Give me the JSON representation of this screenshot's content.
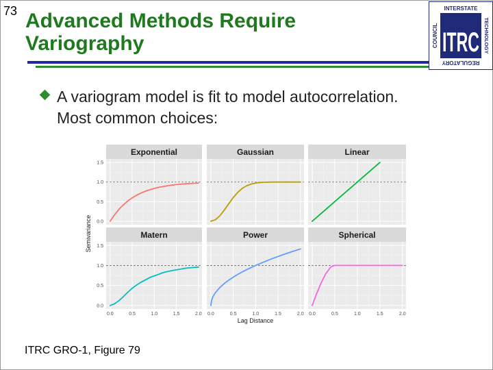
{
  "slide": {
    "number": "73",
    "title_line1": "Advanced Methods Require",
    "title_line2": "Variography",
    "bullet_line1": "A variogram model is fit to model autocorrelation.",
    "bullet_line2": "Most common choices:",
    "caption": "ITRC GRO-1, Figure 79",
    "colors": {
      "title": "#1f7a1f",
      "rule_blue": "#1f2a9c",
      "rule_green": "#2e8b2e"
    }
  },
  "logo": {
    "main": "ITRC",
    "top": "INTERSTATE",
    "right": "TECHNOLOGY",
    "bottom": "REGULATORY",
    "left": "COUNCIL"
  },
  "chart_data": {
    "type": "line",
    "xlabel": "Lag Distance",
    "ylabel": "Semivariance",
    "xlim": [
      0,
      2
    ],
    "ylim": [
      0,
      1.5
    ],
    "x_ticks": [
      "0.0",
      "0.5",
      "1.0",
      "1.5",
      "2.0"
    ],
    "y_ticks": [
      "0.0",
      "0.5",
      "1.0",
      "1.5"
    ],
    "reference_line": {
      "y": 1.0,
      "style": "dashed"
    },
    "grid": true,
    "facets": [
      {
        "name": "Exponential",
        "color": "#F8766D",
        "x": [
          0,
          0.1,
          0.2,
          0.3,
          0.4,
          0.5,
          0.6,
          0.7,
          0.8,
          0.9,
          1.0,
          1.1,
          1.2,
          1.3,
          1.4,
          1.5,
          1.6,
          1.7,
          1.8,
          1.9,
          2.0
        ],
        "y": [
          0,
          0.166,
          0.305,
          0.42,
          0.517,
          0.597,
          0.664,
          0.72,
          0.767,
          0.805,
          0.838,
          0.865,
          0.887,
          0.906,
          0.922,
          0.935,
          0.946,
          0.955,
          0.962,
          0.968,
          0.974
        ]
      },
      {
        "name": "Gaussian",
        "color": "#B79F00",
        "x": [
          0,
          0.1,
          0.2,
          0.3,
          0.4,
          0.5,
          0.6,
          0.7,
          0.8,
          0.9,
          1.0,
          1.1,
          1.2,
          1.3,
          1.4,
          1.5,
          1.6,
          1.7,
          1.8,
          1.9,
          2.0
        ],
        "y": [
          0,
          0.036,
          0.137,
          0.283,
          0.447,
          0.603,
          0.736,
          0.837,
          0.906,
          0.95,
          0.975,
          0.989,
          0.995,
          0.998,
          1,
          1,
          1,
          1,
          1,
          1,
          1
        ]
      },
      {
        "name": "Linear",
        "color": "#00BA38",
        "x": [
          0,
          1.5
        ],
        "y": [
          0,
          1.5
        ]
      },
      {
        "name": "Matern",
        "color": "#00BFC4",
        "x": [
          0,
          0.1,
          0.2,
          0.3,
          0.4,
          0.5,
          0.6,
          0.7,
          0.8,
          0.9,
          1.0,
          1.1,
          1.2,
          1.3,
          1.4,
          1.5,
          1.6,
          1.7,
          1.8,
          1.9,
          2.0
        ],
        "y": [
          0,
          0.04,
          0.12,
          0.22,
          0.33,
          0.43,
          0.51,
          0.58,
          0.64,
          0.7,
          0.74,
          0.78,
          0.82,
          0.85,
          0.87,
          0.89,
          0.91,
          0.93,
          0.94,
          0.95,
          0.96
        ]
      },
      {
        "name": "Power",
        "color": "#619CFF",
        "x": [
          0,
          0.02,
          0.05,
          0.1,
          0.2,
          0.3,
          0.4,
          0.5,
          0.6,
          0.7,
          0.8,
          0.9,
          1.0,
          1.2,
          1.4,
          1.6,
          1.8,
          2.0
        ],
        "y": [
          0,
          0.141,
          0.224,
          0.316,
          0.447,
          0.548,
          0.632,
          0.707,
          0.775,
          0.837,
          0.894,
          0.949,
          1.0,
          1.095,
          1.183,
          1.265,
          1.342,
          1.414
        ]
      },
      {
        "name": "Spherical",
        "color": "#F564E3",
        "x": [
          0,
          0.1,
          0.2,
          0.3,
          0.4,
          0.45,
          0.5,
          2.0
        ],
        "y": [
          0,
          0.296,
          0.568,
          0.792,
          0.944,
          0.986,
          1,
          1
        ]
      }
    ]
  }
}
